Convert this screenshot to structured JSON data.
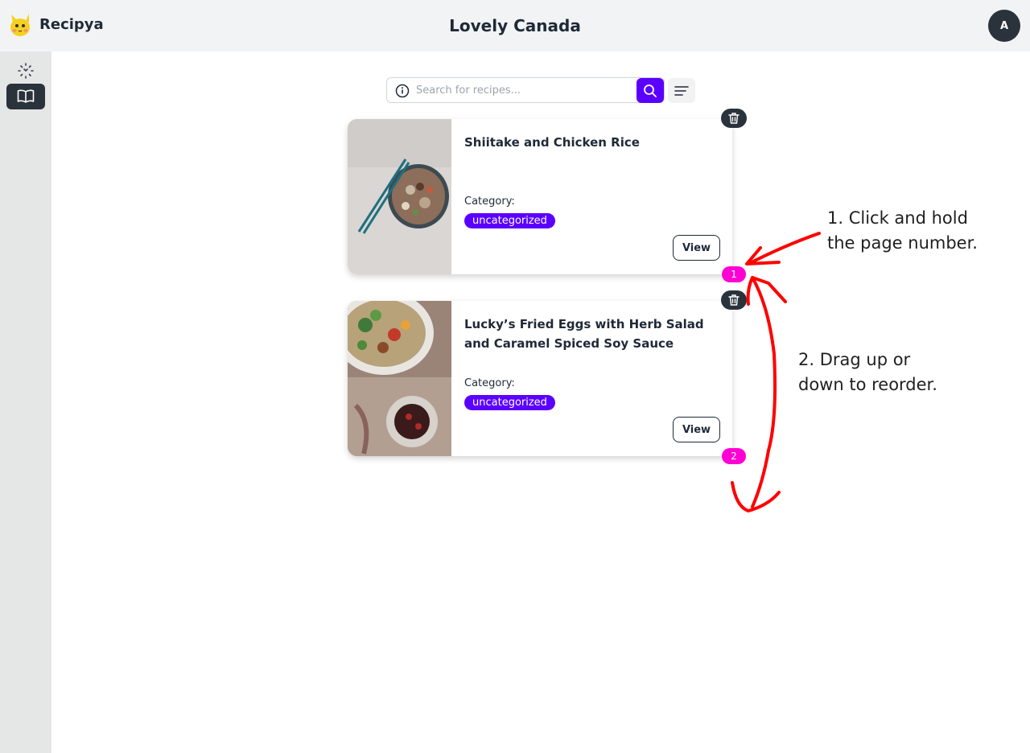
{
  "header": {
    "brand": "Recipya",
    "title": "Lovely Canada",
    "avatar_initial": "A"
  },
  "sidebar": {
    "items": [
      {
        "name": "cookbooks-scan",
        "icon": "scan-icon",
        "active": false
      },
      {
        "name": "recipes",
        "icon": "open-book-icon",
        "active": true
      }
    ]
  },
  "search": {
    "placeholder": "Search for recipes...",
    "value": ""
  },
  "recipes": [
    {
      "title": "Shiitake and Chicken Rice",
      "category_label": "Category:",
      "category": "uncategorized",
      "view_label": "View",
      "page_number": "1"
    },
    {
      "title": "Lucky’s Fried Eggs with Herb Salad and Caramel Spiced Soy Sauce",
      "category_label": "Category:",
      "category": "uncategorized",
      "view_label": "View",
      "page_number": "2"
    }
  ],
  "annotations": {
    "step1_line1": "1. Click and hold",
    "step1_line2": "the page number.",
    "step2_line1": "2. Drag up or",
    "step2_line2": "down to reorder."
  },
  "colors": {
    "accent": "#5b00ff",
    "page_badge": "#ff00d4",
    "dark": "#2a323c",
    "annotation": "#ff0000"
  }
}
